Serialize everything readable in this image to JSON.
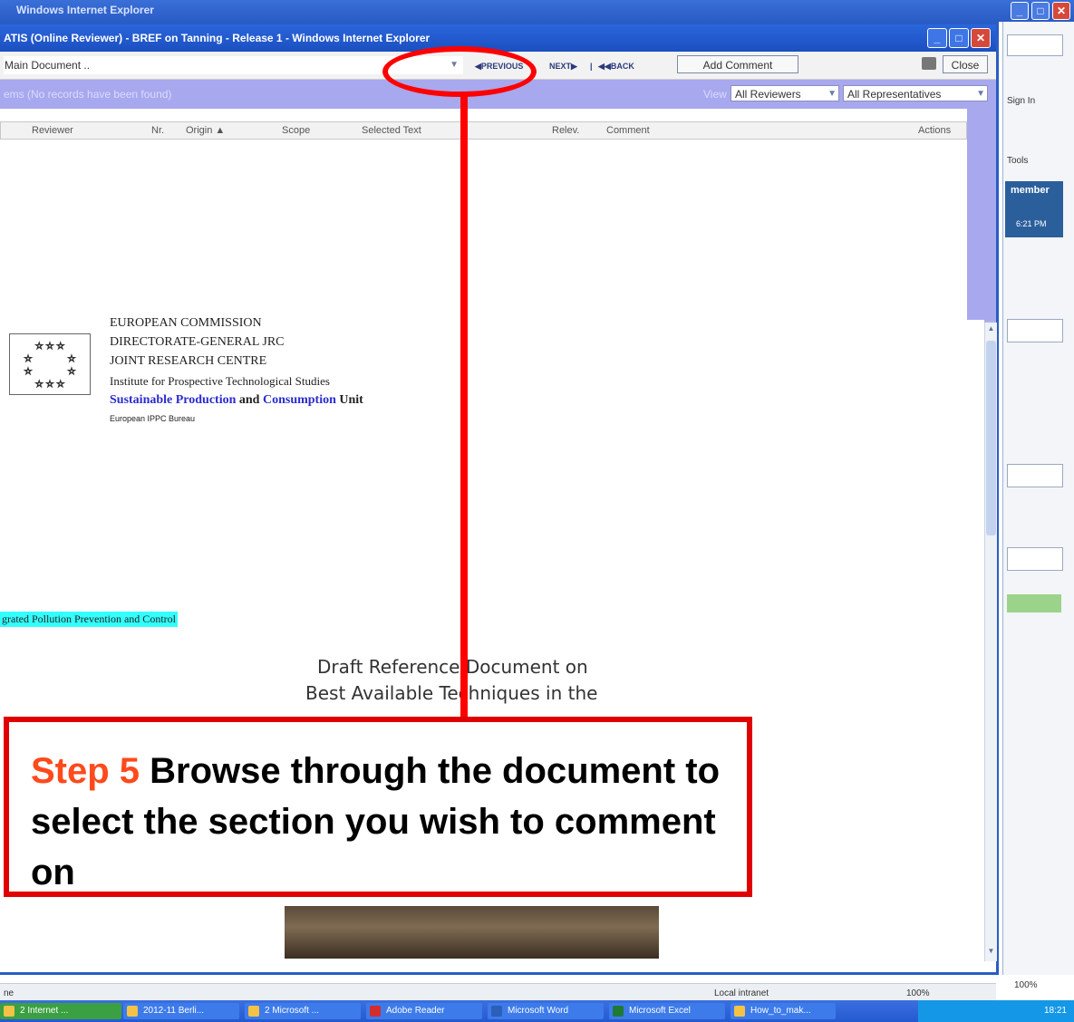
{
  "outer_window": {
    "title": "Windows Internet Explorer",
    "right_strip": {
      "sign_in": "Sign In",
      "tools": "Tools",
      "member": "member",
      "time": "6:21 PM",
      "zoom": "100%"
    }
  },
  "popup": {
    "title": "ATIS (Online Reviewer) - BREF on Tanning - Release 1 - Windows Internet Explorer",
    "toolbar": {
      "document_select": "Main Document ..",
      "previous": "◀PREVIOUS",
      "next": "NEXT▶",
      "separator": "|",
      "back": "◀◀BACK",
      "add_comment": "Add Comment",
      "close": "Close"
    },
    "filter": {
      "records_text": "ems (No records have been found)",
      "view_label": "View",
      "reviewers_select": "All Reviewers",
      "representatives_select": "All Representatives"
    },
    "columns": [
      "Reviewer",
      "Nr.",
      "Origin ▲",
      "Scope",
      "Selected Text",
      "Relev.",
      "Comment",
      "Actions"
    ],
    "document": {
      "header_lines": [
        "EUROPEAN COMMISSION",
        "DIRECTORATE-GENERAL JRC",
        "JOINT RESEARCH CENTRE",
        "Institute for Prospective Technological Studies"
      ],
      "unit_line": {
        "part1": "Sustainable Production",
        "part2": " and ",
        "part3": "Consumption",
        "part4": " Unit"
      },
      "bureau": "European IPPC Bureau",
      "ippc_highlight": "grated Pollution Prevention and Control",
      "draft_line1": "Draft Reference Document on",
      "draft_line2": "Best Available Techniques in the"
    },
    "statusbar": {
      "left": "ne",
      "zone": "Local intranet",
      "zoom": "100%"
    }
  },
  "annotation": {
    "step_label": "Step 5",
    "step_text": "Browse through the document to select the section you wish to comment on",
    "color": "#ff0000"
  },
  "taskbar": {
    "start": "2 Internet ...",
    "items": [
      "2012-11 Berli...",
      "2 Microsoft ...",
      "Adobe Reader",
      "Microsoft Word",
      "Microsoft Excel",
      "How_to_mak..."
    ],
    "clock": "18:21"
  }
}
